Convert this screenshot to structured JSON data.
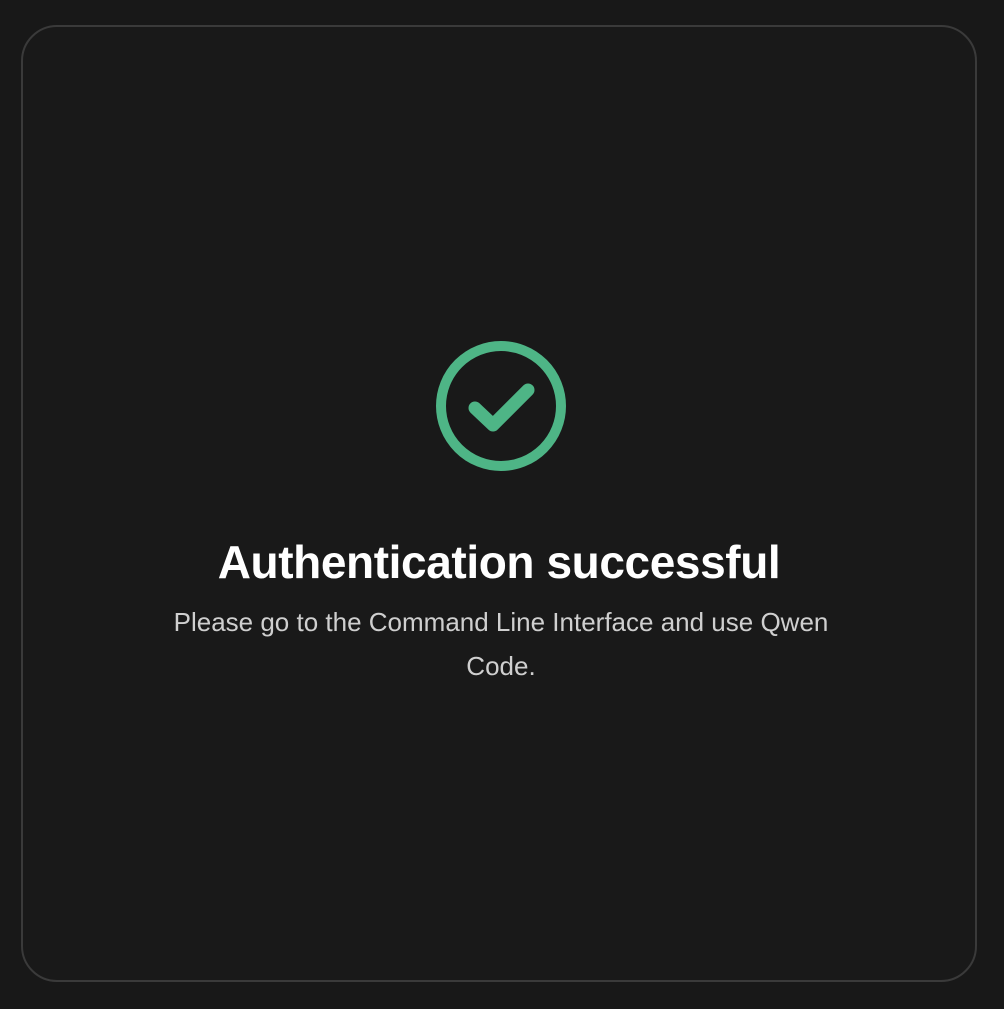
{
  "auth_result": {
    "title": "Authentication successful",
    "message": "Please go to the Command Line Interface and use Qwen Code.",
    "icon": "check-circle-icon"
  },
  "colors": {
    "background": "#181818",
    "card_background": "#191919",
    "card_border": "#3a3a3a",
    "success": "#4eb586",
    "title_text": "#ffffff",
    "body_text": "#cfcfcf"
  }
}
